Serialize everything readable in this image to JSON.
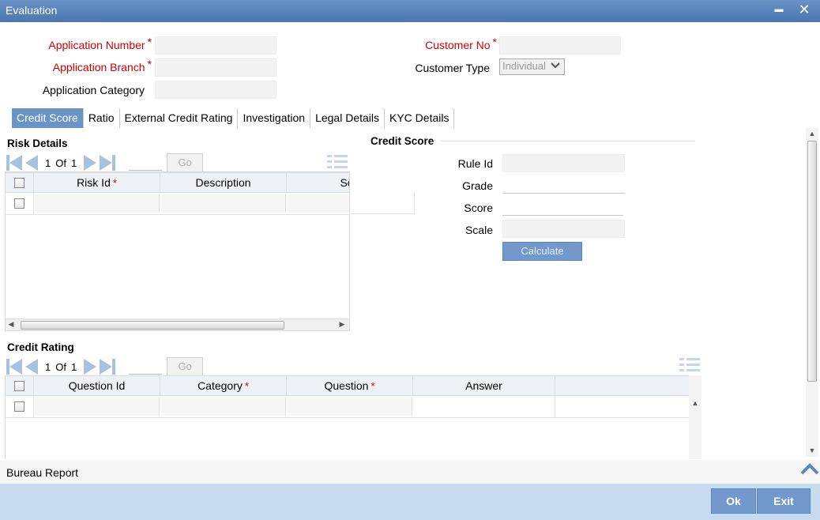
{
  "window": {
    "title": "Evaluation",
    "minimize_glyph": "▬",
    "close_glyph": "✕"
  },
  "header": {
    "application_number_label": "Application Number",
    "application_branch_label": "Application Branch",
    "application_category_label": "Application Category",
    "customer_no_label": "Customer No",
    "customer_type_label": "Customer Type",
    "customer_type_value": "Individual",
    "required_mark": "*"
  },
  "tabs": [
    {
      "label": "Credit Score",
      "active": true
    },
    {
      "label": "Ratio"
    },
    {
      "label": "External Credit Rating"
    },
    {
      "label": "Investigation"
    },
    {
      "label": "Legal Details"
    },
    {
      "label": "KYC Details"
    }
  ],
  "risk_details": {
    "title": "Risk Details",
    "page_current": "1",
    "page_of": "Of",
    "page_total": "1",
    "go_label": "Go",
    "columns": [
      "Risk Id",
      "Description",
      "Sco"
    ]
  },
  "credit_score": {
    "title": "Credit Score",
    "rule_id_label": "Rule Id",
    "grade_label": "Grade",
    "score_label": "Score",
    "scale_label": "Scale",
    "calculate_label": "Calculate"
  },
  "credit_rating": {
    "title": "Credit Rating",
    "page_current": "1",
    "page_of": "Of",
    "page_total": "1",
    "go_label": "Go",
    "columns": [
      "Question Id",
      "Category",
      "Question",
      "Answer"
    ]
  },
  "bureau_report": {
    "label": "Bureau Report"
  },
  "footer": {
    "ok_label": "Ok",
    "exit_label": "Exit"
  },
  "colors": {
    "title_bar": "#5a83ba",
    "active_tab": "#6a93c6",
    "required": "#cc0000",
    "footer": "#c6dbf0"
  }
}
